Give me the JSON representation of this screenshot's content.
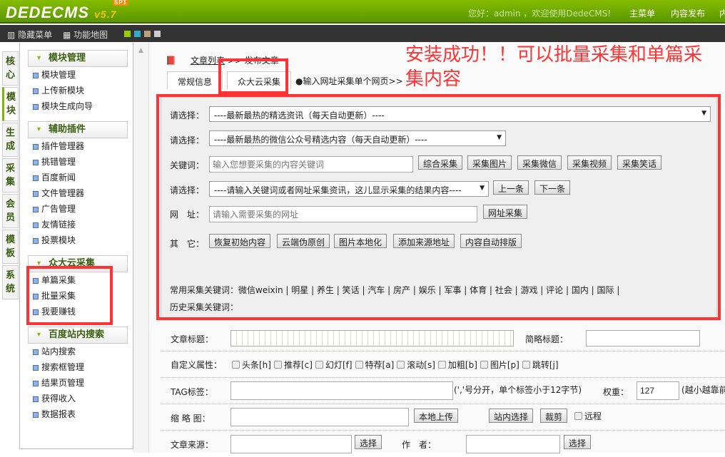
{
  "header": {
    "logo": "DEDECMS",
    "version": "v5.7",
    "badge": "SP1",
    "greeting": "您好：admin ，欢迎使用DedeCMS!",
    "nav": [
      "主菜单",
      "内容发布",
      "内"
    ]
  },
  "toolbar": {
    "hide_menu": "隐藏菜单",
    "func_map": "功能地图",
    "swatches": [
      "#9c0",
      "#3ac",
      "#b9a07a",
      "#ccc"
    ]
  },
  "vtabs": [
    "核心",
    "模块",
    "生成",
    "采集",
    "会员",
    "模板",
    "系统"
  ],
  "sidebar": {
    "sections": [
      {
        "title": "模块管理",
        "items": [
          "模块管理",
          "上传新模块",
          "模块生成向导"
        ]
      },
      {
        "title": "辅助插件",
        "items": [
          "插件管理器",
          "挑错管理",
          "百度新闻",
          "文件管理器",
          "广告管理",
          "友情链接",
          "投票模块"
        ]
      },
      {
        "title": "众大云采集",
        "items": [
          "单篇采集",
          "批量采集",
          "我要赚钱"
        ]
      },
      {
        "title": "百度站内搜索",
        "items": [
          "站内搜索",
          "搜索框管理",
          "结果页管理",
          "获得收入",
          "数据报表"
        ]
      }
    ]
  },
  "breadcrumb": {
    "link": "文章列表",
    "sep": ">>",
    "current": "发布文章"
  },
  "tabs": [
    "常规信息",
    "众大云采集"
  ],
  "tab_hint": "●输入网址采集单个网页>>",
  "annotation": "安装成功！！可以批量采集和单篇采集内容",
  "collect": {
    "select_label": "请选择：",
    "select1": "----最新最热的精选资讯（每天自动更新）----",
    "select2": "----最新最热的微信公众号精选内容（每天自动更新）----",
    "keyword_label": "关键词：",
    "keyword_placeholder": "输入您想要采集的内容关键词",
    "keyword_buttons": [
      "综合采集",
      "采集图片",
      "采集微信",
      "采集视频",
      "采集笑话"
    ],
    "select3": "----请输入关键词或者网址采集资讯，这儿显示采集的结果内容----",
    "prev": "上一条",
    "next": "下一条",
    "url_label": "网　址：",
    "url_placeholder": "请输入需要采集的网址",
    "url_button": "网址采集",
    "other_label": "其　它：",
    "other_buttons": [
      "恢复初始内容",
      "云端伪原创",
      "图片本地化",
      "添加来源地址",
      "内容自动排版"
    ],
    "common_label": "常用采集关键词：",
    "common_keywords": [
      "微信weixin",
      "明星",
      "养生",
      "笑话",
      "汽车",
      "房产",
      "娱乐",
      "军事",
      "体育",
      "社会",
      "游戏",
      "评论",
      "国内",
      "国际"
    ],
    "history_label": "历史采集关键词："
  },
  "form": {
    "title_label": "文章标题：",
    "short_title_label": "简略标题：",
    "attr_label": "自定义属性：",
    "attrs": [
      "头条[h]",
      "推荐[c]",
      "幻灯[f]",
      "特荐[a]",
      "滚动[s]",
      "加粗[b]",
      "图片[p]",
      "跳转[j]"
    ],
    "tag_label": "TAG标签：",
    "tag_hint": "(','号分开，单个标签小于12字节)",
    "weight_label": "权重：",
    "weight": "127",
    "weight_hint": "(越小越靠前",
    "thumb_label": "缩 略 图：",
    "upload": "本地上传",
    "site_select": "站内选择",
    "crop": "裁剪",
    "remote": "远程",
    "source_label": "文章来源：",
    "choose": "选择",
    "author_label": "作　者："
  }
}
